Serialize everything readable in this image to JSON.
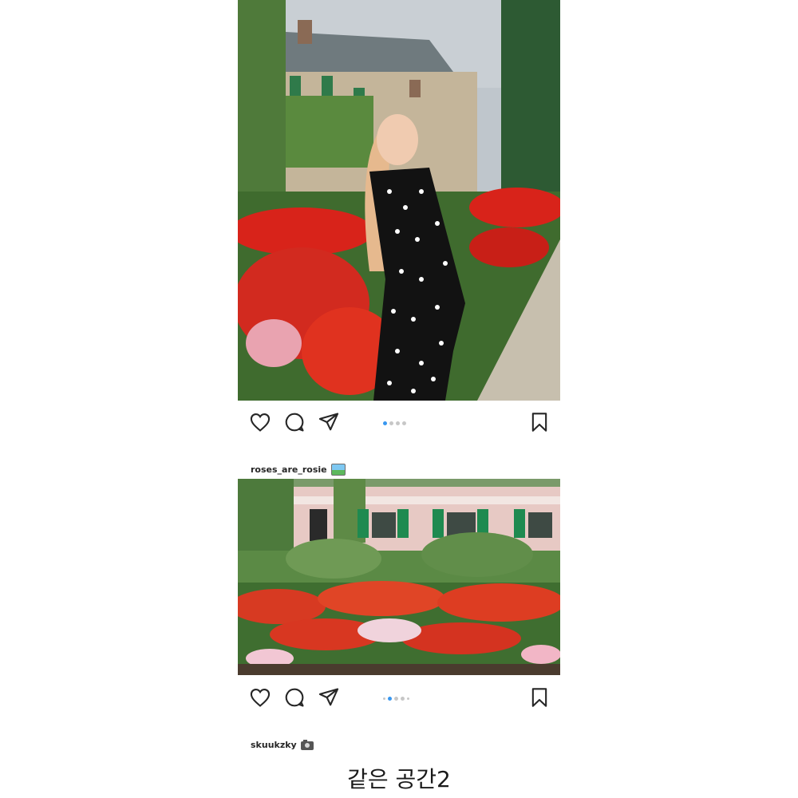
{
  "posts": [
    {
      "active_dot": 0,
      "dot_count": 4
    },
    {
      "username": "roses_are_rosie",
      "username_emoji": "framed-picture-icon",
      "active_dot": 1,
      "dot_count": 5
    }
  ],
  "second_username": "skuukzky",
  "second_username_emoji": "camera-icon",
  "caption": "같은 공간2",
  "colors": {
    "text": "#262626",
    "active_dot": "#3897f0",
    "inactive_dot": "#c7c7c7"
  }
}
